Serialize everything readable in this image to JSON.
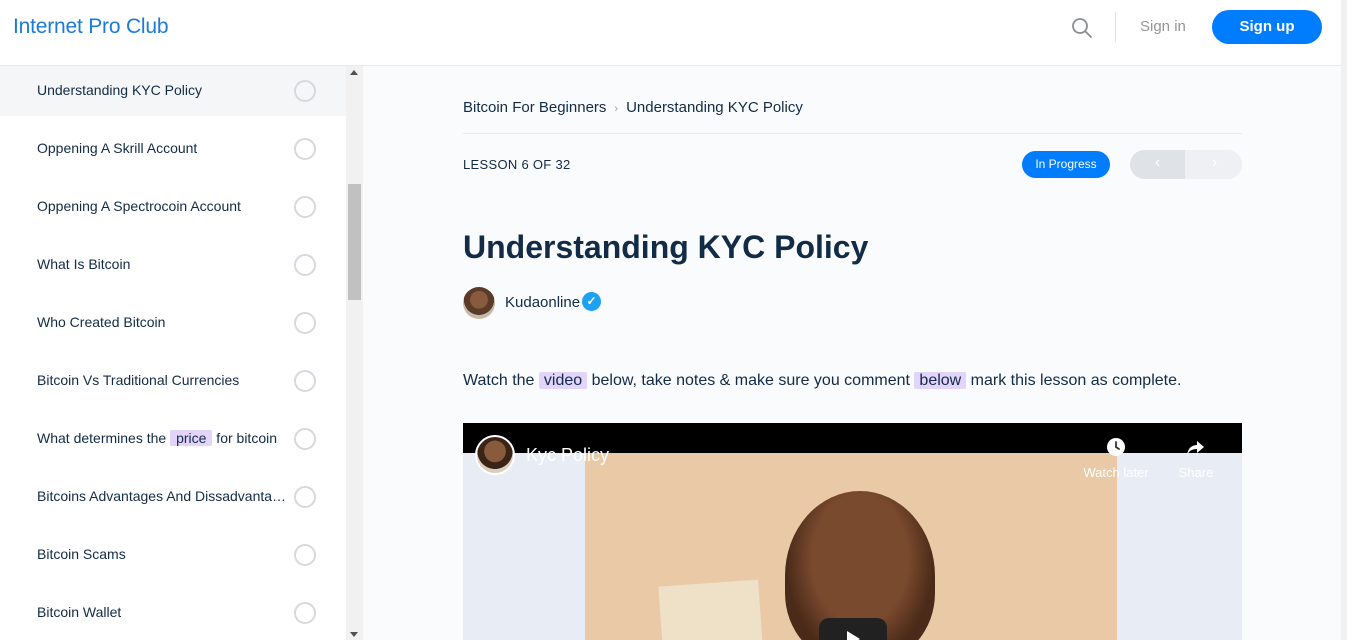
{
  "header": {
    "logo": "Internet Pro Club",
    "signin_label": "Sign in",
    "signup_label": "Sign up",
    "icons": {
      "search": "search-icon"
    }
  },
  "sidebar": {
    "items": [
      {
        "label": "Understanding KYC Policy",
        "active": true
      },
      {
        "label": "Oppening A Skrill Account"
      },
      {
        "label": "Oppening A Spectrocoin Account"
      },
      {
        "label": "What Is Bitcoin"
      },
      {
        "label": "Who Created Bitcoin"
      },
      {
        "label": "Bitcoin Vs Traditional Currencies"
      },
      {
        "label_pre": "What determines the ",
        "label_hl": "price",
        "label_post": " for bitcoin"
      },
      {
        "label": "Bitcoins Advantages And Dissadvantages"
      },
      {
        "label": "Bitcoin Scams"
      },
      {
        "label": "Bitcoin Wallet"
      }
    ]
  },
  "lesson": {
    "breadcrumb": {
      "course": "Bitcoin For Beginners",
      "separator": "›",
      "current": "Understanding KYC Policy"
    },
    "counter": "LESSON 6 OF 32",
    "status": "In Progress",
    "nav": {
      "prev": "‹",
      "next": "›"
    },
    "title": "Understanding KYC Policy",
    "author": "Kudaonline",
    "verified_mark": "✓",
    "intro": {
      "part1": "Watch the ",
      "hl1": "video",
      "part2": " below, take notes & make sure you comment ",
      "hl2": "below",
      "part3": " mark this lesson as complete."
    },
    "video": {
      "title": "Kyc Policy",
      "watch_later": "Watch later",
      "share": "Share"
    }
  },
  "colors": {
    "brand": "#1b7bd8",
    "accent": "#007cff",
    "highlight": "#e3d4fb"
  }
}
